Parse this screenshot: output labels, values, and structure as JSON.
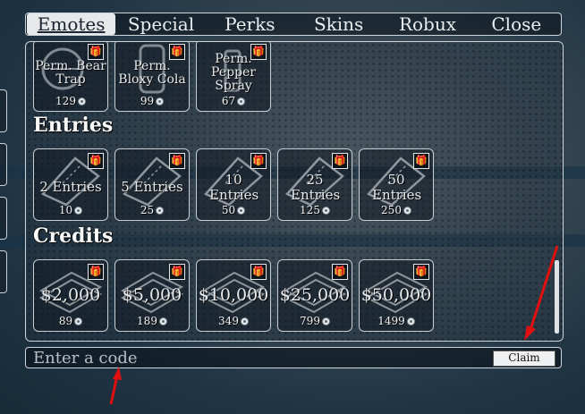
{
  "tabs": [
    {
      "label": "Emotes",
      "active": true
    },
    {
      "label": "Special",
      "active": false
    },
    {
      "label": "Perks",
      "active": false
    },
    {
      "label": "Skins",
      "active": false
    },
    {
      "label": "Robux",
      "active": false
    },
    {
      "label": "Close",
      "active": false
    }
  ],
  "perks": [
    {
      "name": "Perm. Bear Trap",
      "price": "129",
      "icon": "bear-trap-icon"
    },
    {
      "name": "Perm. Bloxy Cola",
      "price": "99",
      "icon": "bloxy-cola-icon"
    },
    {
      "name": "Perm. Pepper Spray",
      "price": "67",
      "icon": "pepper-spray-icon"
    }
  ],
  "sections": {
    "entries_title": "Entries",
    "credits_title": "Credits"
  },
  "entries": [
    {
      "name": "2 Entries",
      "price": "10",
      "icon": "ticket-icon"
    },
    {
      "name": "5 Entries",
      "price": "25",
      "icon": "ticket-icon"
    },
    {
      "name": "10 Entries",
      "price": "50",
      "icon": "ticket-icon"
    },
    {
      "name": "25 Entries",
      "price": "125",
      "icon": "ticket-icon"
    },
    {
      "name": "50 Entries",
      "price": "250",
      "icon": "ticket-icon"
    }
  ],
  "credits": [
    {
      "name": "$2,000",
      "price": "89",
      "icon": "cash-stack-icon"
    },
    {
      "name": "$5,000",
      "price": "189",
      "icon": "cash-stack-icon"
    },
    {
      "name": "$10,000",
      "price": "349",
      "icon": "cash-stack-icon"
    },
    {
      "name": "$25,000",
      "price": "799",
      "icon": "cash-stack-icon"
    },
    {
      "name": "$50,000",
      "price": "1499",
      "icon": "cash-stack-icon"
    }
  ],
  "code": {
    "placeholder": "Enter a code",
    "claim_label": "Claim"
  },
  "colors": {
    "annotation_arrow": "#e01010",
    "panel_border": "#cfd5d9"
  }
}
